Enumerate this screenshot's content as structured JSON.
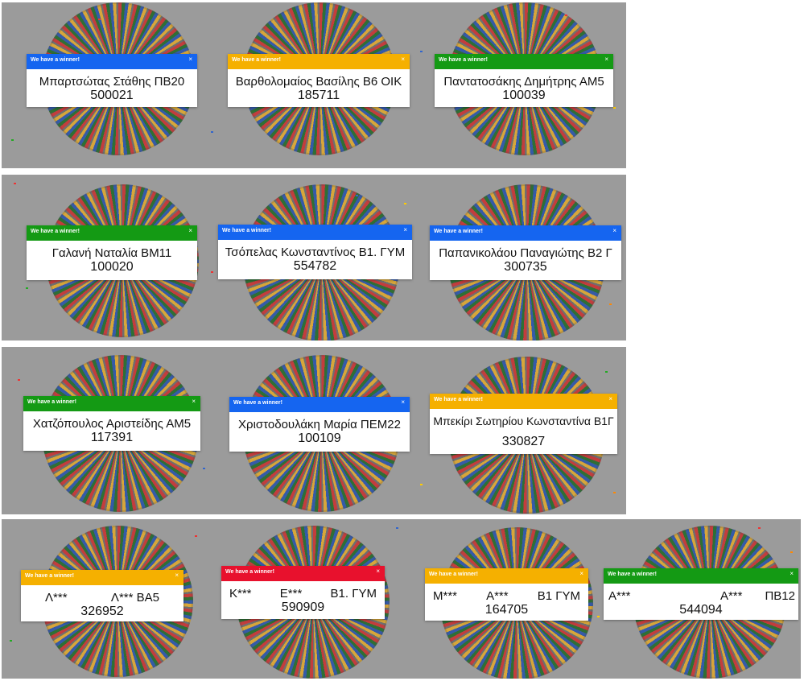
{
  "header_label": "We have a winner!",
  "close_glyph": "×",
  "colors": {
    "blue": "#1565f0",
    "yellow": "#f5b000",
    "green": "#149a14",
    "red": "#e8112d",
    "panel_bg": "#9b9b9b"
  },
  "panels": [
    {
      "cards": [
        {
          "color": "blue",
          "name": "Μπαρτσώτας Στάθης ΠΒ20",
          "number": "500021"
        },
        {
          "color": "yellow",
          "name": "Βαρθολομαίος Βασίλης Β6 ΟΙΚ",
          "number": "185711"
        },
        {
          "color": "green",
          "name": "Παντατοσάκης Δημήτρης ΑΜ5",
          "number": "100039"
        }
      ]
    },
    {
      "cards": [
        {
          "color": "green",
          "name": "Γαλανή Ναταλία ΒΜ11",
          "number": "100020"
        },
        {
          "color": "blue",
          "name": "Τσόπελας Κωνσταντίνος Β1. ΓΥΜ",
          "number": "554782"
        },
        {
          "color": "blue",
          "name": "Παπανικολάου Παναγιώτης Β2 Γ",
          "number": "300735"
        }
      ]
    },
    {
      "cards": [
        {
          "color": "green",
          "name": "Χατζόπουλος Αριστείδης ΑΜ5",
          "number": "117391"
        },
        {
          "color": "blue",
          "name": "Χριστοδουλάκη Μαρία ΠΕΜ22",
          "number": "100109"
        },
        {
          "color": "yellow",
          "name": "Μπεκίρι Σωτηρίου Κωνσταντίνα Β1Γ",
          "number": "330827"
        }
      ]
    },
    {
      "cards": [
        {
          "color": "yellow",
          "name_parts": [
            "Λ***",
            "Λ***",
            "ΒΑ5"
          ],
          "number": "326952"
        },
        {
          "color": "red",
          "name_parts": [
            "Κ***",
            "Ε***",
            "Β1. ΓΥΜ"
          ],
          "number": "590909"
        },
        {
          "color": "yellow",
          "name_parts": [
            "Μ***",
            "Α***",
            "Β1 ΓΥΜ"
          ],
          "number": "164705"
        },
        {
          "color": "green",
          "name_parts": [
            "Α***",
            "Α***",
            "ΠΒ12"
          ],
          "number": "544094"
        }
      ]
    }
  ]
}
